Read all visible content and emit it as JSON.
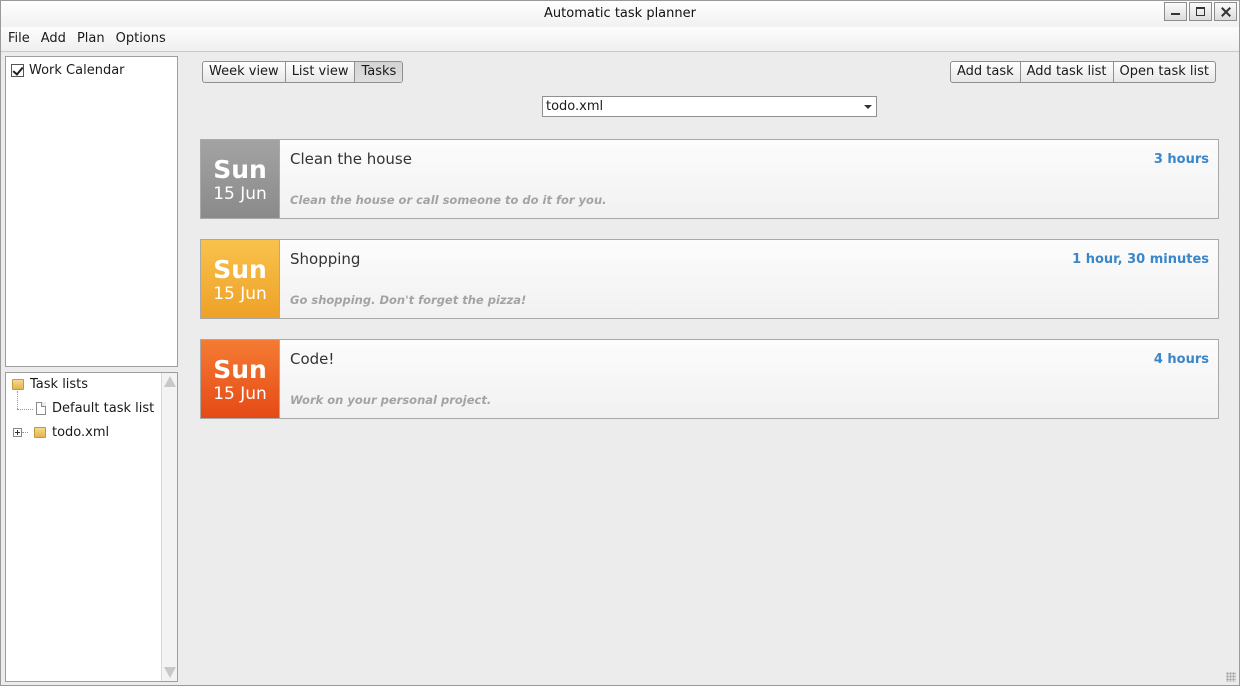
{
  "window": {
    "title": "Automatic task planner"
  },
  "menu": [
    "File",
    "Add",
    "Plan",
    "Options"
  ],
  "calendars": [
    {
      "label": "Work Calendar",
      "checked": true
    }
  ],
  "tree": {
    "root": "Task lists",
    "children": [
      "Default task list",
      "todo.xml"
    ]
  },
  "views": {
    "week": "Week view",
    "list": "List view",
    "tasks": "Tasks",
    "active": "Tasks"
  },
  "actions": {
    "add_task": "Add task",
    "add_task_list": "Add task list",
    "open_task_list": "Open task list"
  },
  "task_list_select": {
    "value": "todo.xml"
  },
  "tasks": [
    {
      "day": "Sun",
      "date": "15 Jun",
      "title": "Clean the house",
      "duration": "3 hours",
      "description": "Clean the house or call someone to do it for you.",
      "color": "#9a9a9a"
    },
    {
      "day": "Sun",
      "date": "15 Jun",
      "title": "Shopping",
      "duration": "1 hour, 30 minutes",
      "description": "Go shopping. Don't forget the pizza!",
      "color": "#f2ae35"
    },
    {
      "day": "Sun",
      "date": "15 Jun",
      "title": "Code!",
      "duration": "4 hours",
      "description": "Work on your personal project.",
      "color": "#ec6325"
    }
  ],
  "colors": {
    "accent_duration": "#3b86c9"
  }
}
